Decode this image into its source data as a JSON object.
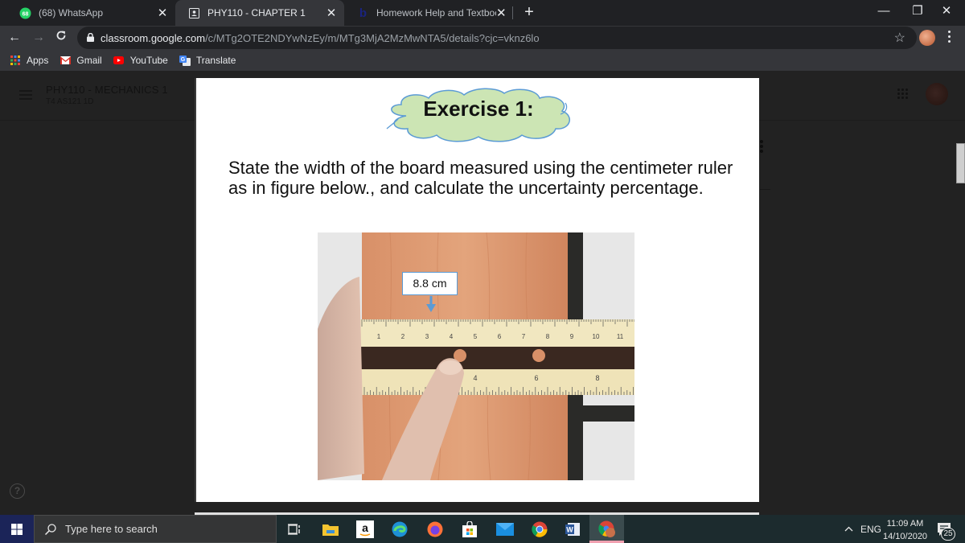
{
  "browser": {
    "tabs": [
      {
        "title": "(68) WhatsApp",
        "badge": "68",
        "favicon": "whatsapp-icon",
        "active": false
      },
      {
        "title": "PHY110 - CHAPTER 1",
        "favicon": "classroom-icon",
        "active": true
      },
      {
        "title": "Homework Help and Textbook So",
        "favicon": "bartleby-icon",
        "active": false
      }
    ],
    "new_tab_label": "+",
    "close_glyph": "✕",
    "window_controls": {
      "minimize": "—",
      "restore": "❐",
      "close": "✕"
    },
    "nav": {
      "back": "←",
      "forward": "→",
      "reload": "C"
    },
    "url": {
      "host": "classroom.google.com",
      "path": "/c/MTg2OTE2NDYwNzEy/m/MTg3MjA2MzMwNTA5/details?cjc=vknz6lo"
    },
    "bookmark_star": "☆",
    "bookmarks": [
      {
        "label": "Apps",
        "icon": "apps-grid-icon"
      },
      {
        "label": "Gmail",
        "icon": "gmail-icon"
      },
      {
        "label": "YouTube",
        "icon": "youtube-icon"
      },
      {
        "label": "Translate",
        "icon": "translate-icon"
      }
    ]
  },
  "classroom": {
    "class_title": "PHY110 - MECHANICS 1",
    "class_subtitle": "T4 AS121 1D",
    "help_glyph": "?"
  },
  "slide": {
    "heading": "Exercise 1:",
    "question": "State the width of the board measured using the centimeter ruler as in figure below., and calculate the uncertainty percentage.",
    "measurement_label": "8.8 cm",
    "ruler_top_numbers": [
      "1",
      "2",
      "3",
      "4",
      "5",
      "6",
      "7",
      "8",
      "9",
      "10",
      "11"
    ],
    "ruler_bottom_numbers": [
      "4",
      "6",
      "8"
    ],
    "colors": {
      "cloud_fill": "#cce5b4",
      "cloud_stroke": "#5b9bd5",
      "label_border": "#5b9bd5"
    }
  },
  "taskbar": {
    "search_placeholder": "Type here to search",
    "pinned": [
      "task-view-icon",
      "file-explorer-icon",
      "amazon-icon",
      "edge-icon",
      "firefox-icon",
      "store-icon",
      "mail-icon",
      "chrome-icon",
      "word-icon",
      "chrome-profile-icon"
    ],
    "tray": {
      "chevron": "^",
      "language": "ENG",
      "time": "11:09 AM",
      "date": "14/10/2020",
      "notifications": "25"
    }
  }
}
